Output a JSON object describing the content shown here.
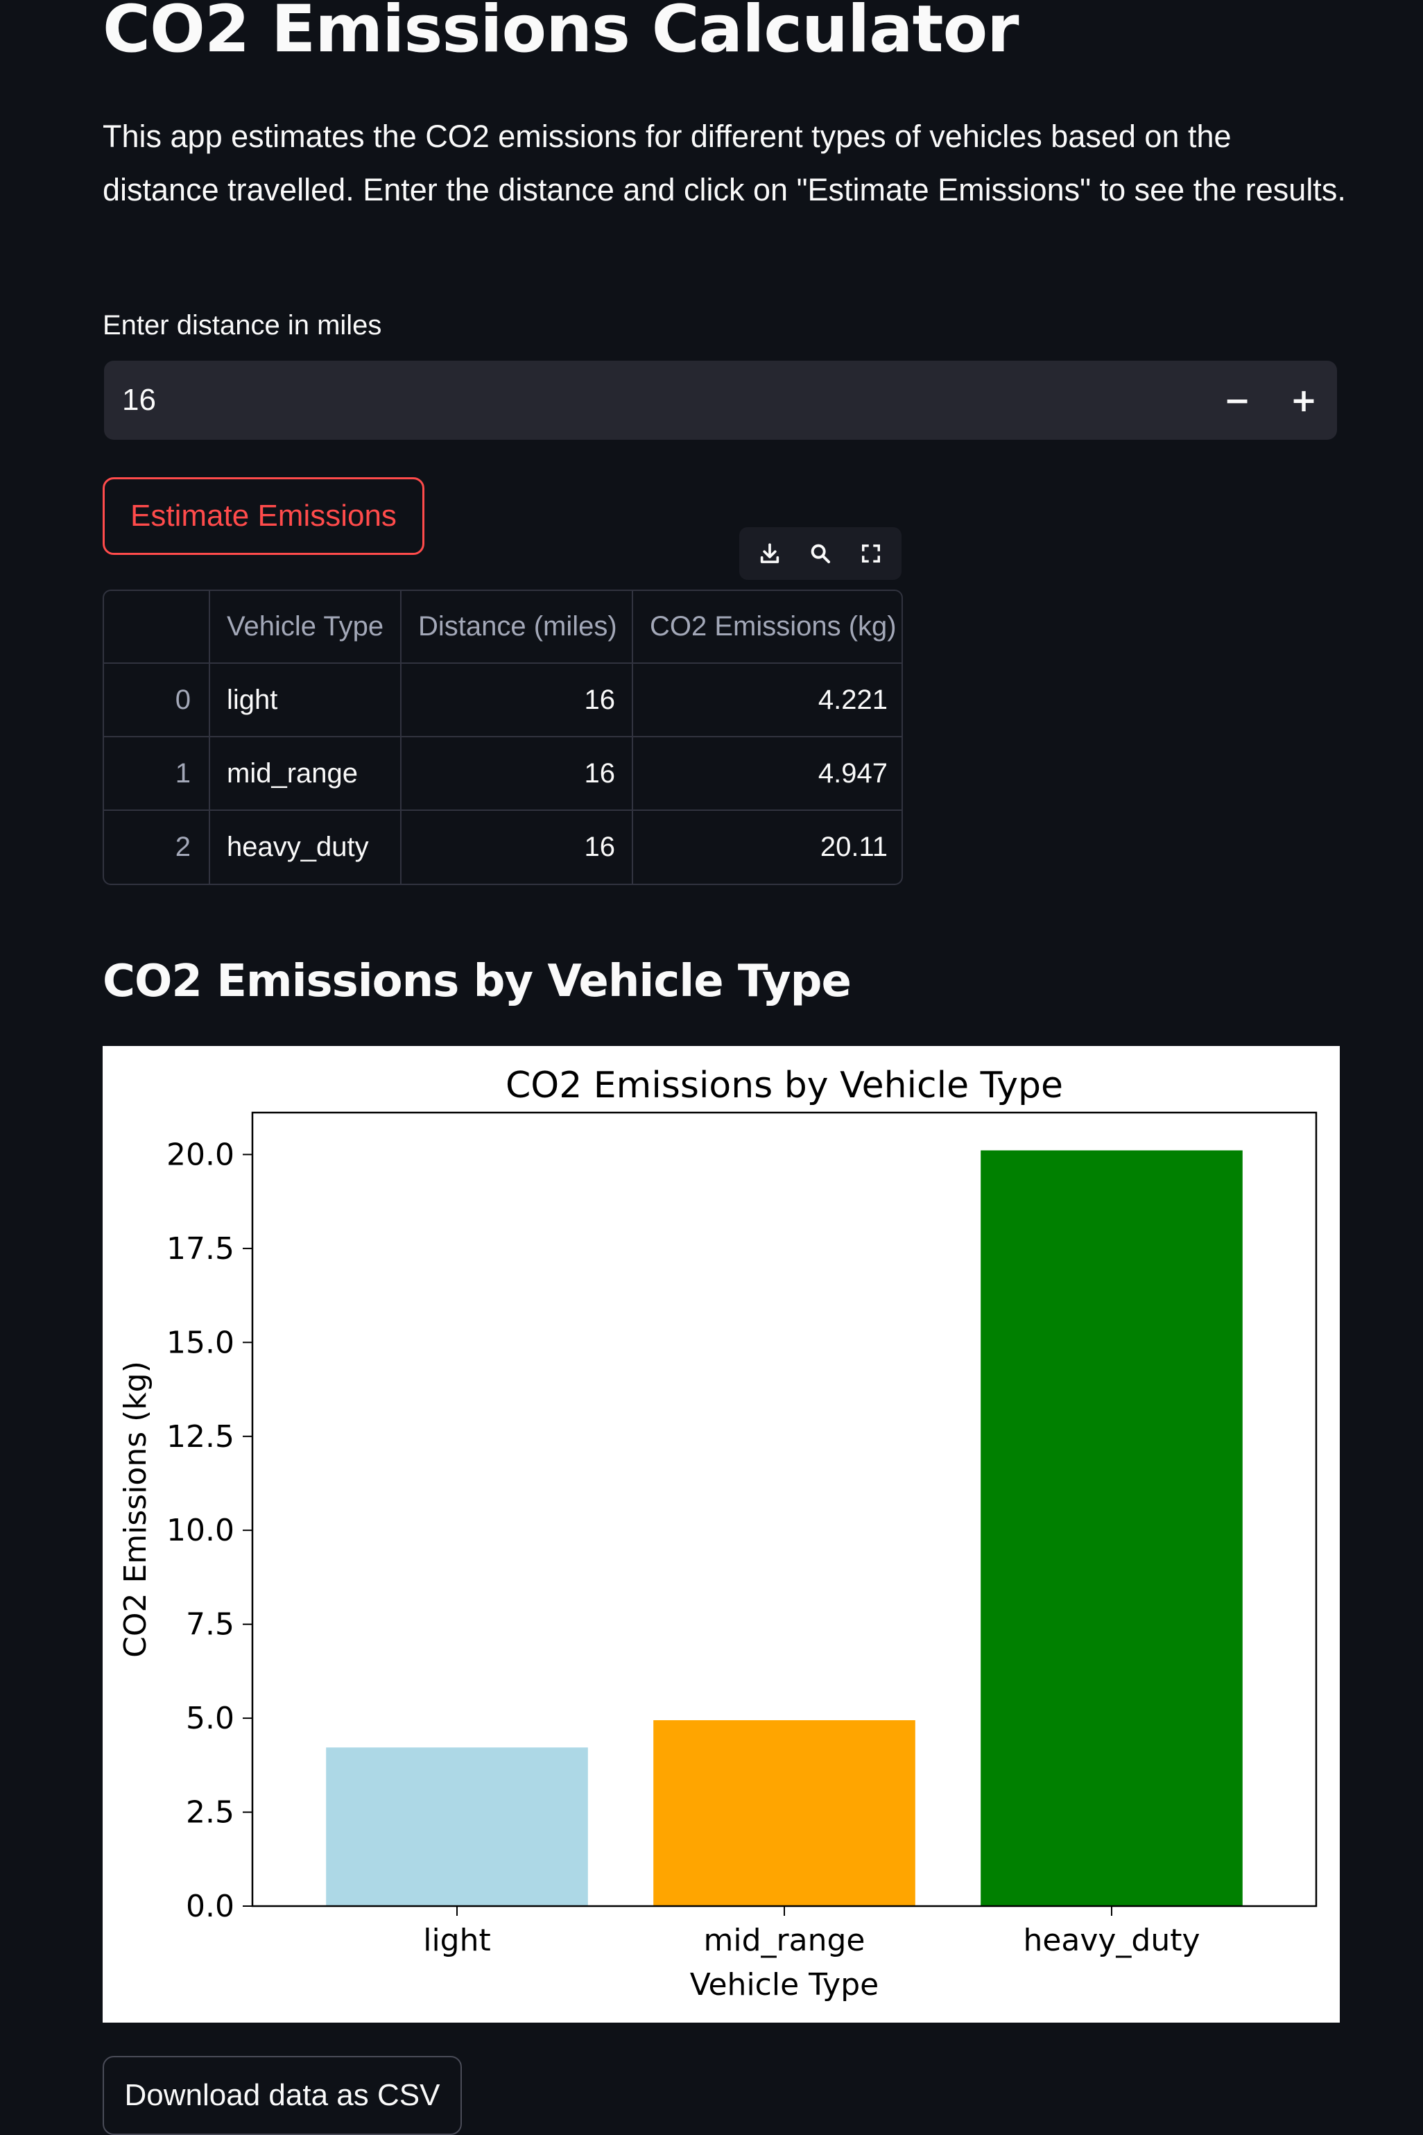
{
  "page": {
    "title": "CO2 Emissions Calculator",
    "description": "This app estimates the CO2 emissions for different types of vehicles based on the distance travelled. Enter the distance and click on \"Estimate Emissions\" to see the results."
  },
  "distance_input": {
    "label": "Enter distance in miles",
    "value": "16",
    "decrement_symbol": "−",
    "increment_symbol": "+"
  },
  "estimate_button": {
    "label": "Estimate Emissions"
  },
  "table_toolbar": {
    "icons": [
      "download-icon",
      "search-icon",
      "fullscreen-icon"
    ]
  },
  "results_table": {
    "columns": [
      "",
      "Vehicle Type",
      "Distance (miles)",
      "CO2 Emissions (kg)"
    ],
    "rows": [
      {
        "index": "0",
        "vehicle_type": "light",
        "distance": "16",
        "emissions": "4.221"
      },
      {
        "index": "1",
        "vehicle_type": "mid_range",
        "distance": "16",
        "emissions": "4.947"
      },
      {
        "index": "2",
        "vehicle_type": "heavy_duty",
        "distance": "16",
        "emissions": "20.11"
      }
    ]
  },
  "chart_section": {
    "heading": "CO2 Emissions by Vehicle Type"
  },
  "chart_data": {
    "type": "bar",
    "title": "CO2 Emissions by Vehicle Type",
    "xlabel": "Vehicle Type",
    "ylabel": "CO2 Emissions (kg)",
    "categories": [
      "light",
      "mid_range",
      "heavy_duty"
    ],
    "values": [
      4.221,
      4.947,
      20.11
    ],
    "colors": [
      "#add8e6",
      "#ffa500",
      "#008000"
    ],
    "ylim": [
      0,
      21.1155
    ],
    "yticks": [
      "0.0",
      "2.5",
      "5.0",
      "7.5",
      "10.0",
      "12.5",
      "15.0",
      "17.5",
      "20.0"
    ],
    "grid": false
  },
  "download_button": {
    "label": "Download data as CSV"
  },
  "theme": {
    "background": "#0e1117",
    "input_background": "#262730",
    "primary": "#ff4b4b",
    "text": "#fafafa"
  }
}
